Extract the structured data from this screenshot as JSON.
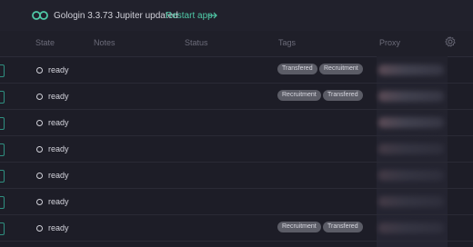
{
  "banner": {
    "logo_icon": "infinity-logo-icon",
    "message": "Gologin 3.3.73 Jupiter updated",
    "action_label": "Restart app",
    "action_icon": "arrow-right-icon",
    "accent": "#4fc8a6"
  },
  "table": {
    "columns": [
      "State",
      "Notes",
      "Status",
      "Tags",
      "Proxy"
    ],
    "settings_icon": "gear-icon",
    "rows": [
      {
        "state": "ready",
        "tags": [
          "Transfered",
          "Recruitment"
        ]
      },
      {
        "state": "ready",
        "tags": [
          "Recruitment",
          "Transfered"
        ]
      },
      {
        "state": "ready",
        "tags": []
      },
      {
        "state": "ready",
        "tags": []
      },
      {
        "state": "ready",
        "tags": []
      },
      {
        "state": "ready",
        "tags": []
      },
      {
        "state": "ready",
        "tags": [
          "Recruitment",
          "Transfered"
        ]
      }
    ]
  }
}
